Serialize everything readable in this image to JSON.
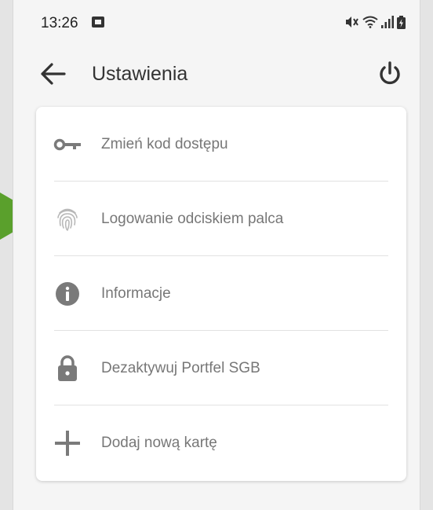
{
  "status": {
    "time": "13:26",
    "icons": [
      "notification-square-icon",
      "mute-icon",
      "wifi-icon",
      "signal-icon",
      "battery-icon"
    ]
  },
  "appbar": {
    "back_icon": "arrow-left-icon",
    "title": "Ustawienia",
    "power_icon": "power-icon"
  },
  "menu": {
    "items": [
      {
        "id": "change-passcode",
        "icon": "key-icon",
        "label": "Zmień kod dostępu"
      },
      {
        "id": "fingerprint-login",
        "icon": "fingerprint-icon",
        "label": "Logowanie odciskiem palca"
      },
      {
        "id": "information",
        "icon": "info-icon",
        "label": "Informacje"
      },
      {
        "id": "deactivate-wallet",
        "icon": "lock-icon",
        "label": "Dezaktywuj Portfel SGB"
      },
      {
        "id": "add-card",
        "icon": "plus-icon",
        "label": "Dodaj nową kartę"
      }
    ]
  },
  "colors": {
    "background": "#f5f5f5",
    "card": "#ffffff",
    "icon_gray": "#7a7a7a",
    "label_gray": "#777777",
    "pointer_green": "#5aa02c"
  }
}
